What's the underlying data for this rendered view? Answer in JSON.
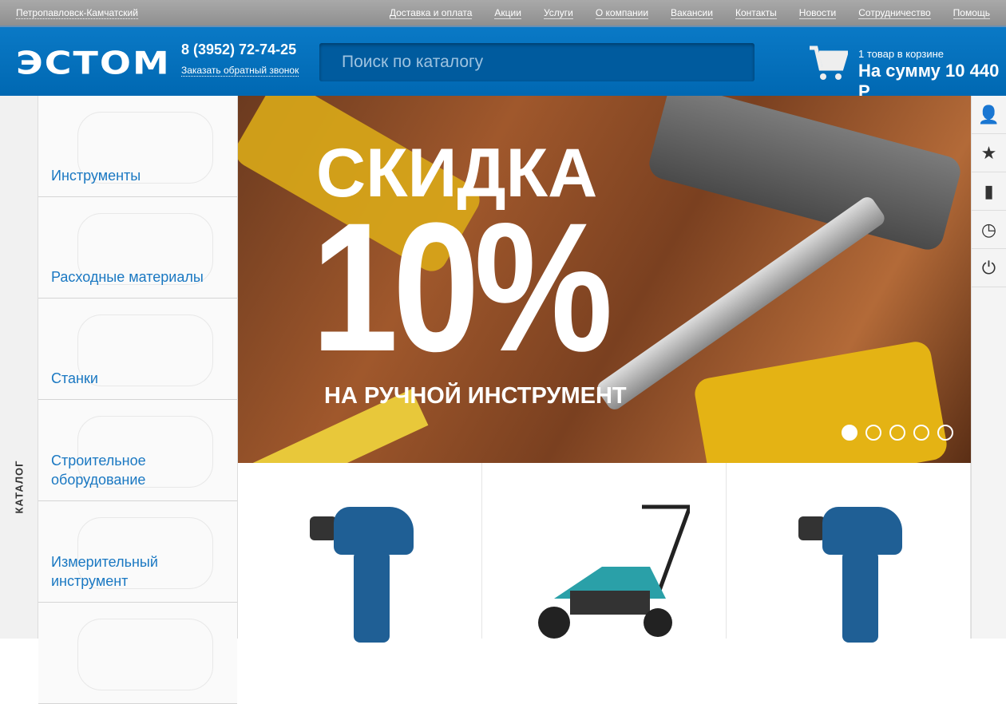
{
  "topbar": {
    "city": "Петропавловск-Камчатский",
    "nav": [
      "Доставка и оплата",
      "Акции",
      "Услуги",
      "О компании",
      "Вакансии",
      "Контакты",
      "Новости",
      "Сотрудничество",
      "Помощь"
    ]
  },
  "header": {
    "logo": "ЭСТОМ",
    "phone": "8 (3952) 72-74-25",
    "callback": "Заказать обратный звонок",
    "search_placeholder": "Поиск по каталогу",
    "cart_count": "1 товар в корзине",
    "cart_sum": "На сумму 10 440 Р"
  },
  "catalog": {
    "label": "КАТАЛОГ",
    "items": [
      "Инструменты",
      "Расходные материалы",
      "Станки",
      "Строительное оборудование",
      "Измерительный инструмент",
      ""
    ]
  },
  "banner": {
    "line1": "СКИДКА",
    "line2": "10%",
    "line3": "НА РУЧНОЙ ИНСТРУМЕНТ",
    "slides": 5,
    "active_slide": 1
  },
  "sidebar_icons": [
    "user-icon",
    "star-icon",
    "chart-icon",
    "clock-icon",
    "power-icon"
  ]
}
